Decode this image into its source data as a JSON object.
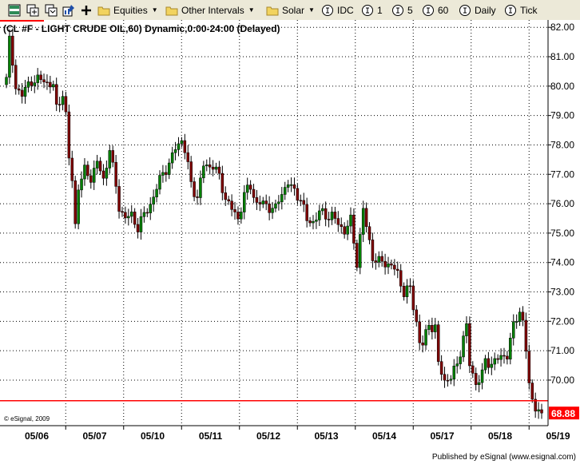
{
  "toolbar": {
    "equities_label": "Equities",
    "other_intervals_label": "Other Intervals",
    "solar_label": "Solar",
    "idc_label": "IDC",
    "interval_1": "1",
    "interval_5": "5",
    "interval_60": "60",
    "daily_label": "Daily",
    "tick_label": "Tick",
    "folder_color": "#f2d35e",
    "icons": [
      "chart-layout-icon",
      "copy-icon",
      "link-icon",
      "properties-icon",
      "add-icon",
      "folder-icon",
      "interval-icon"
    ]
  },
  "chart_data": {
    "type": "candlestick",
    "title": "(CL #F - LIGHT CRUDE OIL,60) Dynamic,0:00-24:00 (Delayed)",
    "copyright": "© eSignal, 2009",
    "ylim": [
      68.45,
      82.25
    ],
    "y_ticks": [
      70.0,
      71.0,
      72.0,
      73.0,
      74.0,
      75.0,
      76.0,
      77.0,
      78.0,
      79.0,
      80.0,
      81.0,
      82.0
    ],
    "y_tick_labels": [
      "70.00",
      "71.00",
      "72.00",
      "73.00",
      "74.00",
      "75.00",
      "76.00",
      "77.00",
      "78.00",
      "79.00",
      "80.00",
      "81.00",
      "82.00"
    ],
    "x_tick_labels": [
      "05/06",
      "05/07",
      "05/10",
      "05/11",
      "05/12",
      "05/13",
      "05/14",
      "05/17",
      "05/18",
      "05/19"
    ],
    "last_price": 68.88,
    "last_price_label": "68.88",
    "reference_line": 69.3,
    "grid": true,
    "colors": {
      "up": "#008000",
      "down": "#800000",
      "grid": "#000000",
      "reference": "#ff0000",
      "price_box": "#ff0000"
    },
    "path": [
      [
        0,
        80.3
      ],
      [
        1,
        81.5
      ],
      [
        3,
        80.0
      ],
      [
        5,
        79.7
      ],
      [
        8,
        80.2
      ],
      [
        12,
        80.2
      ],
      [
        15,
        80.0
      ],
      [
        16,
        79.2
      ],
      [
        18,
        79.8
      ],
      [
        19,
        79.0
      ],
      [
        20,
        77.5
      ],
      [
        21,
        76.8
      ],
      [
        22,
        75.3
      ],
      [
        23,
        76.6
      ],
      [
        25,
        77.1
      ],
      [
        27,
        76.9
      ],
      [
        29,
        77.4
      ],
      [
        31,
        76.8
      ],
      [
        33,
        77.9
      ],
      [
        34,
        77.2
      ],
      [
        36,
        75.9
      ],
      [
        38,
        75.5
      ],
      [
        40,
        75.6
      ],
      [
        42,
        75.2
      ],
      [
        46,
        76.0
      ],
      [
        48,
        76.5
      ],
      [
        50,
        77.1
      ],
      [
        52,
        77.3
      ],
      [
        54,
        77.9
      ],
      [
        56,
        78.2
      ],
      [
        57,
        77.8
      ],
      [
        59,
        76.7
      ],
      [
        61,
        76.2
      ],
      [
        63,
        77.3
      ],
      [
        66,
        77.3
      ],
      [
        68,
        76.9
      ],
      [
        70,
        76.2
      ],
      [
        72,
        75.8
      ],
      [
        74,
        75.5
      ],
      [
        76,
        76.3
      ],
      [
        78,
        76.6
      ],
      [
        80,
        76.0
      ],
      [
        82,
        76.0
      ],
      [
        84,
        75.9
      ],
      [
        86,
        75.8
      ],
      [
        88,
        76.4
      ],
      [
        90,
        76.7
      ],
      [
        92,
        76.4
      ],
      [
        94,
        76.2
      ],
      [
        96,
        75.4
      ],
      [
        98,
        75.4
      ],
      [
        100,
        75.7
      ],
      [
        102,
        75.6
      ],
      [
        104,
        75.6
      ],
      [
        106,
        75.3
      ],
      [
        108,
        75.1
      ],
      [
        110,
        75.4
      ],
      [
        112,
        74.0
      ],
      [
        114,
        75.8
      ],
      [
        115,
        75.2
      ],
      [
        117,
        74.2
      ],
      [
        119,
        74.0
      ],
      [
        121,
        74.0
      ],
      [
        123,
        73.9
      ],
      [
        125,
        73.6
      ],
      [
        127,
        73.0
      ],
      [
        129,
        73.1
      ],
      [
        130,
        72.5
      ],
      [
        131,
        72.0
      ],
      [
        132,
        71.3
      ],
      [
        133,
        71.2
      ],
      [
        135,
        71.9
      ],
      [
        137,
        71.8
      ],
      [
        138,
        70.5
      ],
      [
        140,
        70.0
      ],
      [
        142,
        70.1
      ],
      [
        144,
        70.5
      ],
      [
        146,
        71.5
      ],
      [
        147,
        71.8
      ],
      [
        148,
        70.5
      ],
      [
        150,
        69.9
      ],
      [
        152,
        70.2
      ],
      [
        153,
        70.6
      ],
      [
        155,
        70.6
      ],
      [
        157,
        70.7
      ],
      [
        160,
        70.9
      ],
      [
        162,
        71.8
      ],
      [
        164,
        72.4
      ],
      [
        165,
        72.0
      ],
      [
        166,
        71.0
      ],
      [
        167,
        69.8
      ],
      [
        168,
        69.3
      ],
      [
        170,
        69.0
      ],
      [
        171,
        68.9
      ]
    ]
  },
  "footer": {
    "publisher": "Published by eSignal (www.esignal.com)"
  }
}
